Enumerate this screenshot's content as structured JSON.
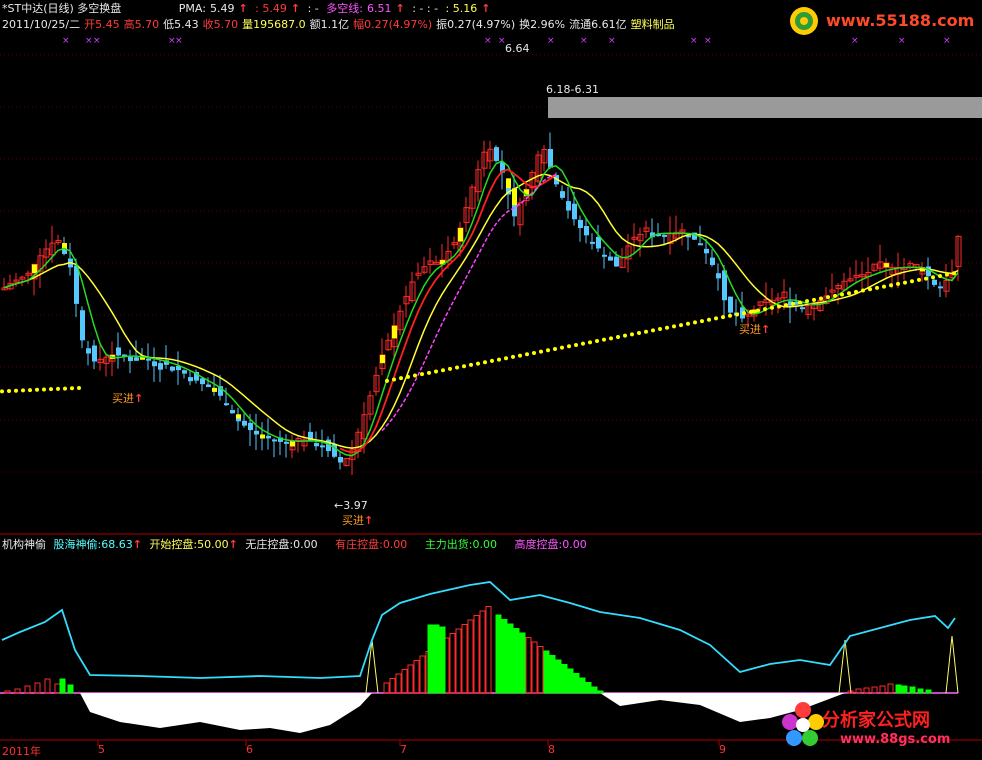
{
  "main_header": {
    "title": "*ST中达(日线) 多空换盘",
    "pma_label": "PMA:",
    "pma_value": "5.49",
    "v2": ": 5.49",
    "v3": ": -",
    "dkx_label": "多空线:",
    "dkx_value": "6.51",
    "v5": ": - : -",
    "v6": ": 5.16"
  },
  "quote": {
    "date": "2011/10/25/二",
    "open_label": "开",
    "open": "5.45",
    "high_label": "高",
    "high": "5.70",
    "low_label": "低",
    "low": "5.43",
    "close_label": "收",
    "close": "5.70",
    "vol_label": "量",
    "vol": "195687.0",
    "amt_label": "额",
    "amt": "1.1亿",
    "chg_label": "幅",
    "chg": "0.27(4.97%)",
    "amp_label": "振",
    "amp": "0.27(4.97%)",
    "turn_label": "换",
    "turn": "2.96%",
    "float_label": "流通",
    "float": "6.61亿",
    "industry": "塑料制品"
  },
  "indicator_header": {
    "name": "机构神偷",
    "items": [
      {
        "label": "股海神偷:",
        "value": "68.63",
        "color": "#55ffff",
        "arrow": true
      },
      {
        "label": "开始控盘:",
        "value": "50.00",
        "color": "#ffff55",
        "arrow": true
      },
      {
        "label": "无庄控盘:",
        "value": "0.00",
        "color": "#e8e8e8",
        "arrow": false
      },
      {
        "label": "有庄控盘:",
        "value": "0.00",
        "color": "#ff3b3b",
        "arrow": false
      },
      {
        "label": "主力出货:",
        "value": "0.00",
        "color": "#33ff33",
        "arrow": false
      },
      {
        "label": "高度控盘:",
        "value": "0.00",
        "color": "#ff55ff",
        "arrow": false
      }
    ]
  },
  "annotations": {
    "high_label": "6.64",
    "range_label": "6.18-6.31",
    "low_label": "←3.97",
    "buy1": "买进",
    "buy2": "买进",
    "buy3": "买进"
  },
  "x_axis": {
    "year": "2011年",
    "months": [
      "5",
      "6",
      "7",
      "8",
      "9"
    ]
  },
  "watermarks": {
    "top_site": "www.55188.com",
    "bottom_brand": "分析家公式网",
    "bottom_url": "www.88gs.com"
  },
  "colors": {
    "up": "#ff2a2a",
    "down": "#55c8ff",
    "yellow_line": "#ffff33",
    "green_line": "#22dd22",
    "red_line": "#ff2020",
    "magenta_line": "#ff44ff",
    "dotted_line": "#ffff00",
    "cyan_line": "#33ddff",
    "green_bar": "#00ff00"
  },
  "chart_data": {
    "type": "candlestick",
    "price_range": [
      3.6,
      7.0
    ],
    "high": 6.64,
    "low": 3.97,
    "resistance_zone": [
      6.18,
      6.31
    ]
  }
}
